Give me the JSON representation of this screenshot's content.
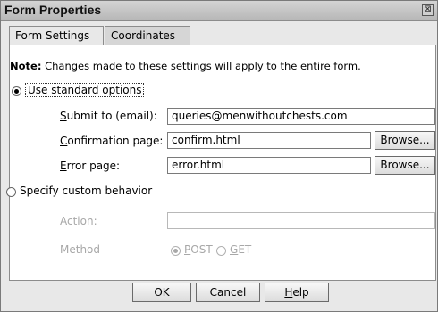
{
  "window": {
    "title": "Form Properties",
    "close_glyph": "⊠"
  },
  "tabs": [
    {
      "label": "Form Settings",
      "active": true
    },
    {
      "label": "Coordinates",
      "active": false
    }
  ],
  "note": {
    "prefix": "Note:",
    "text": " Changes made to these settings will apply to the entire form."
  },
  "standard": {
    "label": "Use standard options",
    "selected": true,
    "submit": {
      "mn": "S",
      "rest": "ubmit to (email):",
      "value": "queries@menwithoutchests.com"
    },
    "confirm": {
      "mn": "C",
      "rest": "onfirmation page:",
      "value": "confirm.html"
    },
    "error": {
      "mn": "E",
      "rest": "rror page:",
      "value": "error.html"
    },
    "browse_label": "Browse..."
  },
  "custom": {
    "label": "Specify custom behavior",
    "selected": false,
    "action": {
      "mn": "A",
      "rest": "ction:",
      "value": ""
    },
    "method": {
      "label": "Method",
      "post": {
        "mn": "P",
        "rest": "OST",
        "selected": true
      },
      "get": {
        "mn": "G",
        "rest": "ET",
        "selected": false
      }
    }
  },
  "buttons": {
    "ok": "OK",
    "cancel": "Cancel",
    "help_mn": "H",
    "help_rest": "elp"
  }
}
